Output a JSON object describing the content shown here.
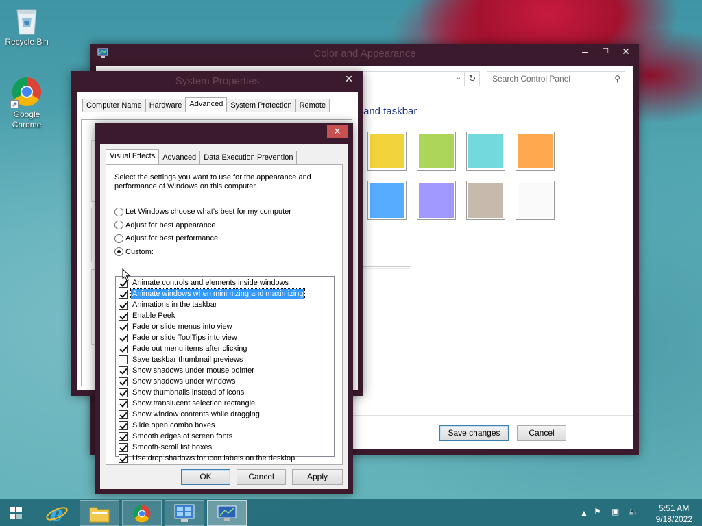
{
  "desktop": {
    "recycle_bin": "Recycle Bin",
    "chrome_line1": "Google",
    "chrome_line2": "Chrome"
  },
  "color_appearance": {
    "title": "Color and Appearance",
    "search_placeholder": "Search Control Panel",
    "heading": "and taskbar",
    "swatches_row1": [
      "#f2d33c",
      "#acd65a",
      "#74d9dc",
      "#ffa84d"
    ],
    "swatches_row2": [
      "#57acff",
      "#a199ff",
      "#c8b9ad",
      "#fafafa"
    ],
    "save_label": "Save changes",
    "cancel_label": "Cancel"
  },
  "system_properties": {
    "title": "System Properties",
    "tabs": [
      "Computer Name",
      "Hardware",
      "Advanced",
      "System Protection",
      "Remote"
    ],
    "active_tab": "Advanced"
  },
  "performance_options": {
    "tabs": [
      "Visual Effects",
      "Advanced",
      "Data Execution Prevention"
    ],
    "active_tab": "Visual Effects",
    "intro": "Select the settings you want to use for the appearance and performance of Windows on this computer.",
    "radios": [
      {
        "label": "Let Windows choose what’s best for my computer",
        "checked": false
      },
      {
        "label": "Adjust for best appearance",
        "checked": false
      },
      {
        "label": "Adjust for best performance",
        "checked": false
      },
      {
        "label": "Custom:",
        "checked": true
      }
    ],
    "effects": [
      {
        "label": "Animate controls and elements inside windows",
        "checked": true
      },
      {
        "label": "Animate windows when minimizing and maximizing",
        "checked": true,
        "selected": true
      },
      {
        "label": "Animations in the taskbar",
        "checked": true
      },
      {
        "label": "Enable Peek",
        "checked": true
      },
      {
        "label": "Fade or slide menus into view",
        "checked": true
      },
      {
        "label": "Fade or slide ToolTips into view",
        "checked": true
      },
      {
        "label": "Fade out menu items after clicking",
        "checked": true
      },
      {
        "label": "Save taskbar thumbnail previews",
        "checked": false
      },
      {
        "label": "Show shadows under mouse pointer",
        "checked": true
      },
      {
        "label": "Show shadows under windows",
        "checked": true
      },
      {
        "label": "Show thumbnails instead of icons",
        "checked": true
      },
      {
        "label": "Show translucent selection rectangle",
        "checked": true
      },
      {
        "label": "Show window contents while dragging",
        "checked": true
      },
      {
        "label": "Slide open combo boxes",
        "checked": true
      },
      {
        "label": "Smooth edges of screen fonts",
        "checked": true
      },
      {
        "label": "Smooth-scroll list boxes",
        "checked": true
      },
      {
        "label": "Use drop shadows for icon labels on the desktop",
        "checked": true
      }
    ],
    "ok_label": "OK",
    "cancel_label": "Cancel",
    "apply_label": "Apply"
  },
  "taskbar": {
    "time": "5:51 AM",
    "date": "9/18/2022",
    "apps": [
      "internet-explorer",
      "file-explorer",
      "google-chrome",
      "control-panel",
      "system-properties"
    ]
  }
}
